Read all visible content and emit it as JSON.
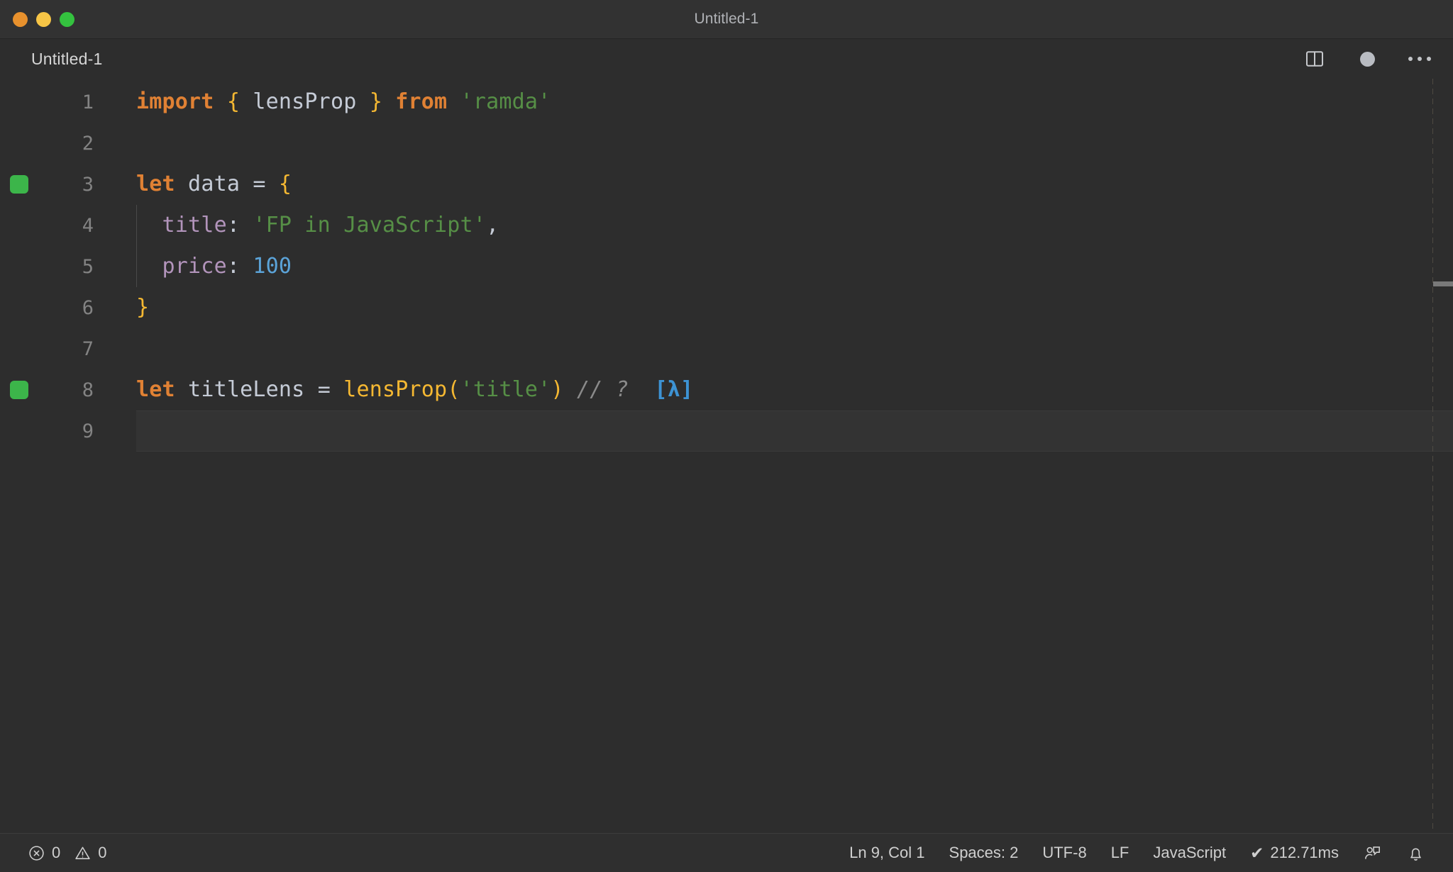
{
  "window": {
    "title": "Untitled-1",
    "traffic_lights": [
      {
        "name": "close",
        "color": "#e8912d"
      },
      {
        "name": "minimize",
        "color": "#f7c546"
      },
      {
        "name": "maximize",
        "color": "#34c23f"
      }
    ]
  },
  "tab": {
    "label": "Untitled-1",
    "actions": {
      "split_editor": "split-editor-icon",
      "dirty_indicator": "unsaved-changes-dot",
      "more_actions": "more-actions-icon"
    }
  },
  "editor": {
    "language": "JavaScript",
    "lines": [
      {
        "no": "1",
        "marker": false,
        "tokens": [
          {
            "t": "import",
            "c": "t-kw"
          },
          {
            "t": " ",
            "c": "t-punct"
          },
          {
            "t": "{",
            "c": "t-brace"
          },
          {
            "t": " lensProp ",
            "c": "t-var"
          },
          {
            "t": "}",
            "c": "t-brace"
          },
          {
            "t": " ",
            "c": "t-punct"
          },
          {
            "t": "from",
            "c": "t-kw"
          },
          {
            "t": " ",
            "c": "t-punct"
          },
          {
            "t": "'ramda'",
            "c": "t-str"
          }
        ]
      },
      {
        "no": "2",
        "marker": false,
        "tokens": []
      },
      {
        "no": "3",
        "marker": true,
        "tokens": [
          {
            "t": "let",
            "c": "t-kw"
          },
          {
            "t": " data ",
            "c": "t-var"
          },
          {
            "t": "=",
            "c": "t-punct"
          },
          {
            "t": " ",
            "c": "t-punct"
          },
          {
            "t": "{",
            "c": "t-brace"
          }
        ]
      },
      {
        "no": "4",
        "marker": false,
        "tokens": [
          {
            "t": "  title",
            "c": "t-prop"
          },
          {
            "t": ": ",
            "c": "t-punct"
          },
          {
            "t": "'FP in JavaScript'",
            "c": "t-str"
          },
          {
            "t": ",",
            "c": "t-punct"
          }
        ]
      },
      {
        "no": "5",
        "marker": false,
        "tokens": [
          {
            "t": "  price",
            "c": "t-prop"
          },
          {
            "t": ": ",
            "c": "t-punct"
          },
          {
            "t": "100",
            "c": "t-num"
          }
        ]
      },
      {
        "no": "6",
        "marker": false,
        "tokens": [
          {
            "t": "}",
            "c": "t-brace"
          }
        ]
      },
      {
        "no": "7",
        "marker": false,
        "tokens": []
      },
      {
        "no": "8",
        "marker": true,
        "tokens": [
          {
            "t": "let",
            "c": "t-kw"
          },
          {
            "t": " titleLens ",
            "c": "t-var"
          },
          {
            "t": "=",
            "c": "t-punct"
          },
          {
            "t": " ",
            "c": "t-punct"
          },
          {
            "t": "lensProp",
            "c": "t-fn"
          },
          {
            "t": "(",
            "c": "t-brace"
          },
          {
            "t": "'title'",
            "c": "t-str"
          },
          {
            "t": ")",
            "c": "t-brace"
          },
          {
            "t": " ",
            "c": "t-punct"
          },
          {
            "t": "// ?",
            "c": "t-comment"
          },
          {
            "t": "  ",
            "c": "t-punct"
          },
          {
            "t": "[λ]",
            "c": "t-lambda"
          }
        ]
      },
      {
        "no": "9",
        "marker": false,
        "current": true,
        "tokens": []
      }
    ]
  },
  "statusbar": {
    "errors_icon": "error-circle-icon",
    "errors_count": "0",
    "warnings_icon": "warning-triangle-icon",
    "warnings_count": "0",
    "cursor_position": "Ln 9, Col 1",
    "indentation": "Spaces: 2",
    "encoding": "UTF-8",
    "eol": "LF",
    "language_mode": "JavaScript",
    "run_check_glyph": "✔",
    "run_time": "212.71ms",
    "feedback_icon": "feedback-person-icon",
    "notifications_icon": "bell-icon"
  }
}
